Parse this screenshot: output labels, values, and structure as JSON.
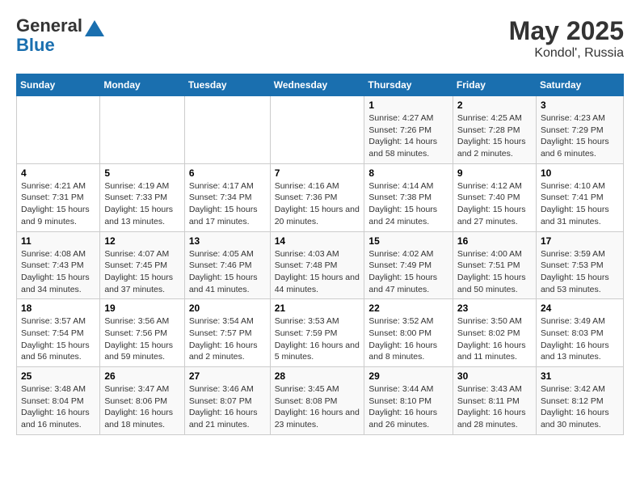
{
  "header": {
    "logo_general": "General",
    "logo_blue": "Blue",
    "title": "May 2025",
    "subtitle": "Kondol', Russia"
  },
  "weekdays": [
    "Sunday",
    "Monday",
    "Tuesday",
    "Wednesday",
    "Thursday",
    "Friday",
    "Saturday"
  ],
  "weeks": [
    [
      {
        "day": "",
        "info": ""
      },
      {
        "day": "",
        "info": ""
      },
      {
        "day": "",
        "info": ""
      },
      {
        "day": "",
        "info": ""
      },
      {
        "day": "1",
        "info": "Sunrise: 4:27 AM\nSunset: 7:26 PM\nDaylight: 14 hours and 58 minutes."
      },
      {
        "day": "2",
        "info": "Sunrise: 4:25 AM\nSunset: 7:28 PM\nDaylight: 15 hours and 2 minutes."
      },
      {
        "day": "3",
        "info": "Sunrise: 4:23 AM\nSunset: 7:29 PM\nDaylight: 15 hours and 6 minutes."
      }
    ],
    [
      {
        "day": "4",
        "info": "Sunrise: 4:21 AM\nSunset: 7:31 PM\nDaylight: 15 hours and 9 minutes."
      },
      {
        "day": "5",
        "info": "Sunrise: 4:19 AM\nSunset: 7:33 PM\nDaylight: 15 hours and 13 minutes."
      },
      {
        "day": "6",
        "info": "Sunrise: 4:17 AM\nSunset: 7:34 PM\nDaylight: 15 hours and 17 minutes."
      },
      {
        "day": "7",
        "info": "Sunrise: 4:16 AM\nSunset: 7:36 PM\nDaylight: 15 hours and 20 minutes."
      },
      {
        "day": "8",
        "info": "Sunrise: 4:14 AM\nSunset: 7:38 PM\nDaylight: 15 hours and 24 minutes."
      },
      {
        "day": "9",
        "info": "Sunrise: 4:12 AM\nSunset: 7:40 PM\nDaylight: 15 hours and 27 minutes."
      },
      {
        "day": "10",
        "info": "Sunrise: 4:10 AM\nSunset: 7:41 PM\nDaylight: 15 hours and 31 minutes."
      }
    ],
    [
      {
        "day": "11",
        "info": "Sunrise: 4:08 AM\nSunset: 7:43 PM\nDaylight: 15 hours and 34 minutes."
      },
      {
        "day": "12",
        "info": "Sunrise: 4:07 AM\nSunset: 7:45 PM\nDaylight: 15 hours and 37 minutes."
      },
      {
        "day": "13",
        "info": "Sunrise: 4:05 AM\nSunset: 7:46 PM\nDaylight: 15 hours and 41 minutes."
      },
      {
        "day": "14",
        "info": "Sunrise: 4:03 AM\nSunset: 7:48 PM\nDaylight: 15 hours and 44 minutes."
      },
      {
        "day": "15",
        "info": "Sunrise: 4:02 AM\nSunset: 7:49 PM\nDaylight: 15 hours and 47 minutes."
      },
      {
        "day": "16",
        "info": "Sunrise: 4:00 AM\nSunset: 7:51 PM\nDaylight: 15 hours and 50 minutes."
      },
      {
        "day": "17",
        "info": "Sunrise: 3:59 AM\nSunset: 7:53 PM\nDaylight: 15 hours and 53 minutes."
      }
    ],
    [
      {
        "day": "18",
        "info": "Sunrise: 3:57 AM\nSunset: 7:54 PM\nDaylight: 15 hours and 56 minutes."
      },
      {
        "day": "19",
        "info": "Sunrise: 3:56 AM\nSunset: 7:56 PM\nDaylight: 15 hours and 59 minutes."
      },
      {
        "day": "20",
        "info": "Sunrise: 3:54 AM\nSunset: 7:57 PM\nDaylight: 16 hours and 2 minutes."
      },
      {
        "day": "21",
        "info": "Sunrise: 3:53 AM\nSunset: 7:59 PM\nDaylight: 16 hours and 5 minutes."
      },
      {
        "day": "22",
        "info": "Sunrise: 3:52 AM\nSunset: 8:00 PM\nDaylight: 16 hours and 8 minutes."
      },
      {
        "day": "23",
        "info": "Sunrise: 3:50 AM\nSunset: 8:02 PM\nDaylight: 16 hours and 11 minutes."
      },
      {
        "day": "24",
        "info": "Sunrise: 3:49 AM\nSunset: 8:03 PM\nDaylight: 16 hours and 13 minutes."
      }
    ],
    [
      {
        "day": "25",
        "info": "Sunrise: 3:48 AM\nSunset: 8:04 PM\nDaylight: 16 hours and 16 minutes."
      },
      {
        "day": "26",
        "info": "Sunrise: 3:47 AM\nSunset: 8:06 PM\nDaylight: 16 hours and 18 minutes."
      },
      {
        "day": "27",
        "info": "Sunrise: 3:46 AM\nSunset: 8:07 PM\nDaylight: 16 hours and 21 minutes."
      },
      {
        "day": "28",
        "info": "Sunrise: 3:45 AM\nSunset: 8:08 PM\nDaylight: 16 hours and 23 minutes."
      },
      {
        "day": "29",
        "info": "Sunrise: 3:44 AM\nSunset: 8:10 PM\nDaylight: 16 hours and 26 minutes."
      },
      {
        "day": "30",
        "info": "Sunrise: 3:43 AM\nSunset: 8:11 PM\nDaylight: 16 hours and 28 minutes."
      },
      {
        "day": "31",
        "info": "Sunrise: 3:42 AM\nSunset: 8:12 PM\nDaylight: 16 hours and 30 minutes."
      }
    ]
  ]
}
